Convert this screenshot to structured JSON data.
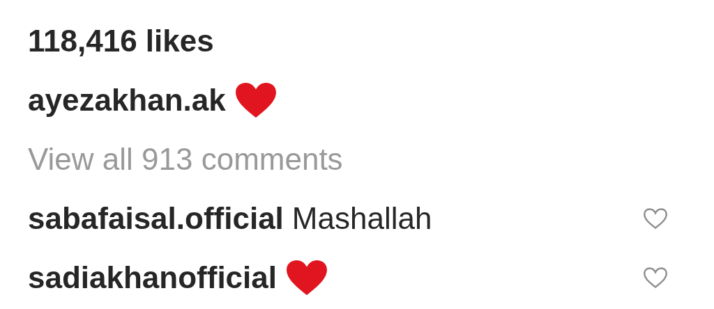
{
  "likes": "118,416 likes",
  "caption": {
    "username": "ayezakhan.ak",
    "kind": "heart"
  },
  "view_all": "View all 913 comments",
  "comments": [
    {
      "username": "sabafaisal.official",
      "kind": "text",
      "text": "Mashallah",
      "liked": false
    },
    {
      "username": "sadiakhanofficial",
      "kind": "heart",
      "liked": false
    }
  ]
}
